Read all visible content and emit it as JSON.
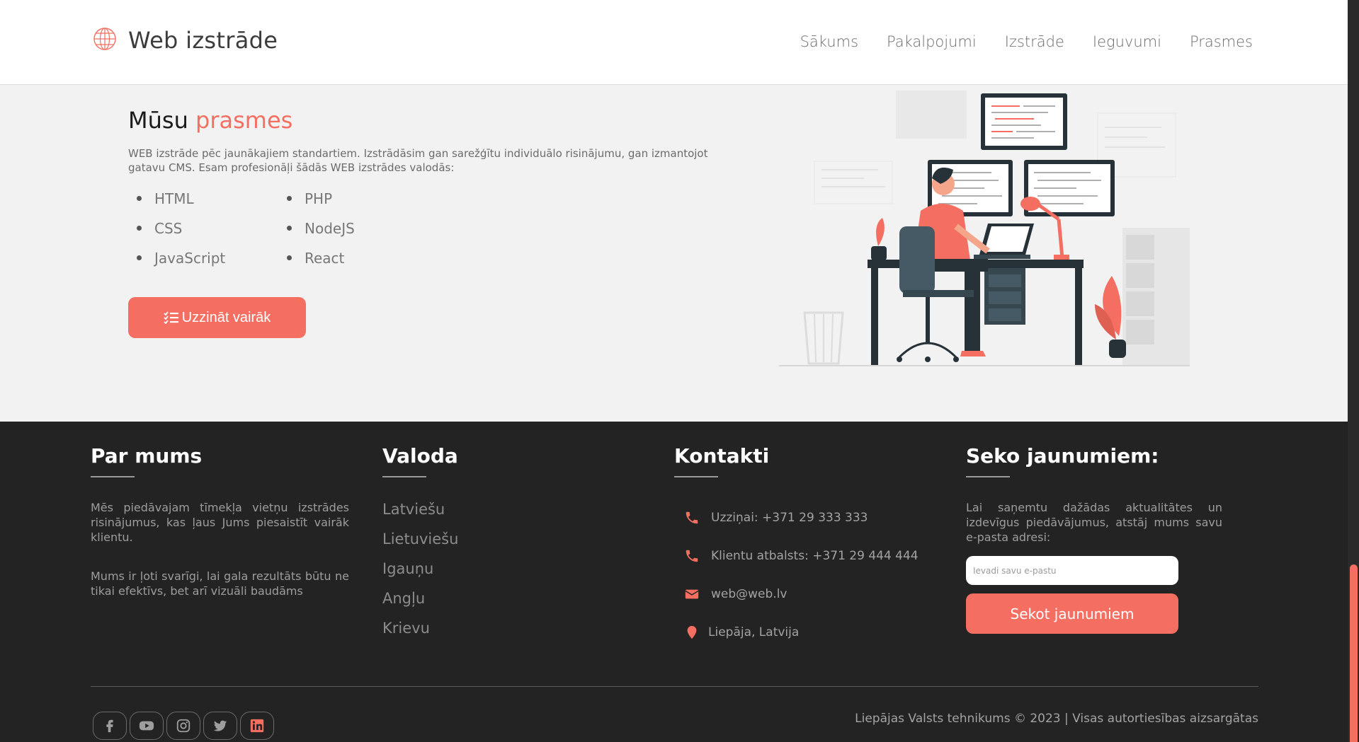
{
  "colors": {
    "accent": "#f46f61",
    "footer_bg": "#232323",
    "page_bg": "#f2f2f2"
  },
  "header": {
    "brand": "Web izstrāde",
    "logo_icon": "globe-icon",
    "nav": [
      "Sākums",
      "Pakalpojumi",
      "Izstrāde",
      "Ieguvumi",
      "Prasmes"
    ]
  },
  "hero": {
    "title_plain": "Mūsu",
    "title_accent": "prasmes",
    "description": "WEB izstrāde pēc jaunākajiem standartiem. Izstrādāsim gan sarežģītu individuālo risinājumu, gan izmantojot gatavu CMS. Esam profesionāļi šādās WEB izstrādes valodās:",
    "skills": [
      "HTML",
      "PHP",
      "CSS",
      "NodeJS",
      "JavaScript",
      "React"
    ],
    "cta_label": "Uzzināt vairāk",
    "cta_icon": "list-check-icon"
  },
  "footer": {
    "about": {
      "title": "Par mums",
      "p1": "Mēs piedāvajam tīmekļa vietņu izstrādes risinājumus, kas ļaus Jums piesaistīt vairāk klientu.",
      "p2": "Mums ir ļoti svarīgi, lai gala rezultāts būtu ne tikai efektīvs, bet arī vizuāli baudāms"
    },
    "language": {
      "title": "Valoda",
      "items": [
        "Latviešu",
        "Lietuviešu",
        "Igauņu",
        "Angļu",
        "Krievu"
      ]
    },
    "contacts": {
      "title": "Kontakti",
      "items": [
        {
          "icon": "phone-icon",
          "text": "Uzziņai: +371 29 333 333"
        },
        {
          "icon": "phone-icon",
          "text": "Klientu atbalsts: +371 29 444 444"
        },
        {
          "icon": "envelope-icon",
          "text": "web@web.lv"
        },
        {
          "icon": "map-pin-icon",
          "text": "Liepāja, Latvija"
        }
      ]
    },
    "follow": {
      "title": "Seko jaunumiem:",
      "text": "Lai saņemtu dažādas aktualitātes un izdevīgus piedāvājumus, atstāj mums savu e-pasta adresi:",
      "placeholder": "Ievadi savu e-pastu",
      "button": "Sekot jaunumiem"
    },
    "socials": [
      "facebook-icon",
      "youtube-icon",
      "instagram-icon",
      "twitter-icon",
      "linkedin-icon"
    ],
    "copyright": "Liepājas Valsts tehnikums © 2023 | Visas autortiesības aizsargātas"
  }
}
